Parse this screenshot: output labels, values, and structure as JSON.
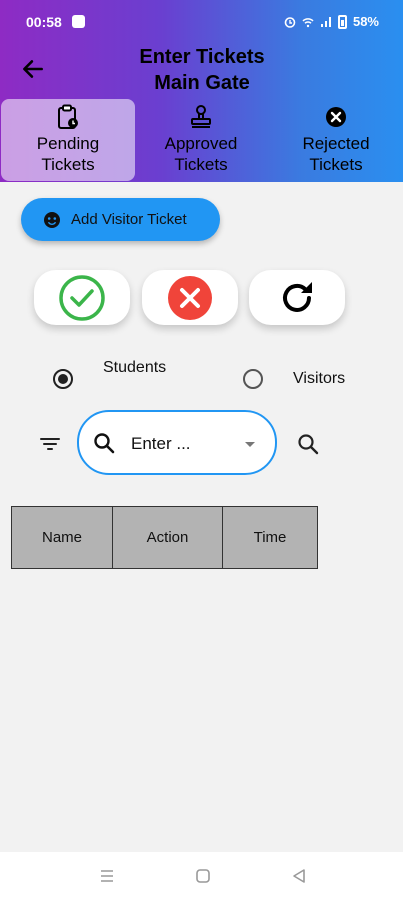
{
  "status_bar": {
    "time": "00:58",
    "battery": "58%"
  },
  "header": {
    "title_line1": "Enter Tickets",
    "title_line2": "Main Gate"
  },
  "tabs": [
    {
      "label_line1": "Pending",
      "label_line2": "Tickets",
      "icon": "clipboard-clock-icon",
      "active": true
    },
    {
      "label_line1": "Approved",
      "label_line2": "Tickets",
      "icon": "stamp-icon",
      "active": false
    },
    {
      "label_line1": "Rejected",
      "label_line2": "Tickets",
      "icon": "cancel-circle-icon",
      "active": false
    }
  ],
  "add_visitor_button": {
    "label": "Add Visitor Ticket",
    "icon": "face-icon"
  },
  "actions": {
    "approve_icon": "check-circle-icon",
    "reject_icon": "cancel-icon",
    "refresh_icon": "refresh-icon"
  },
  "radio_group": {
    "options": [
      {
        "label": "Students",
        "selected": true
      },
      {
        "label": "Visitors",
        "selected": false
      }
    ]
  },
  "search": {
    "value": "Enter ..."
  },
  "table": {
    "columns": [
      "Name",
      "Action",
      "Time"
    ]
  },
  "colors": {
    "primary": "#2196f3",
    "approve": "#3bb54a",
    "reject": "#f0443a",
    "gradient_start": "#8e2bc4",
    "gradient_end": "#2a8ff0"
  }
}
